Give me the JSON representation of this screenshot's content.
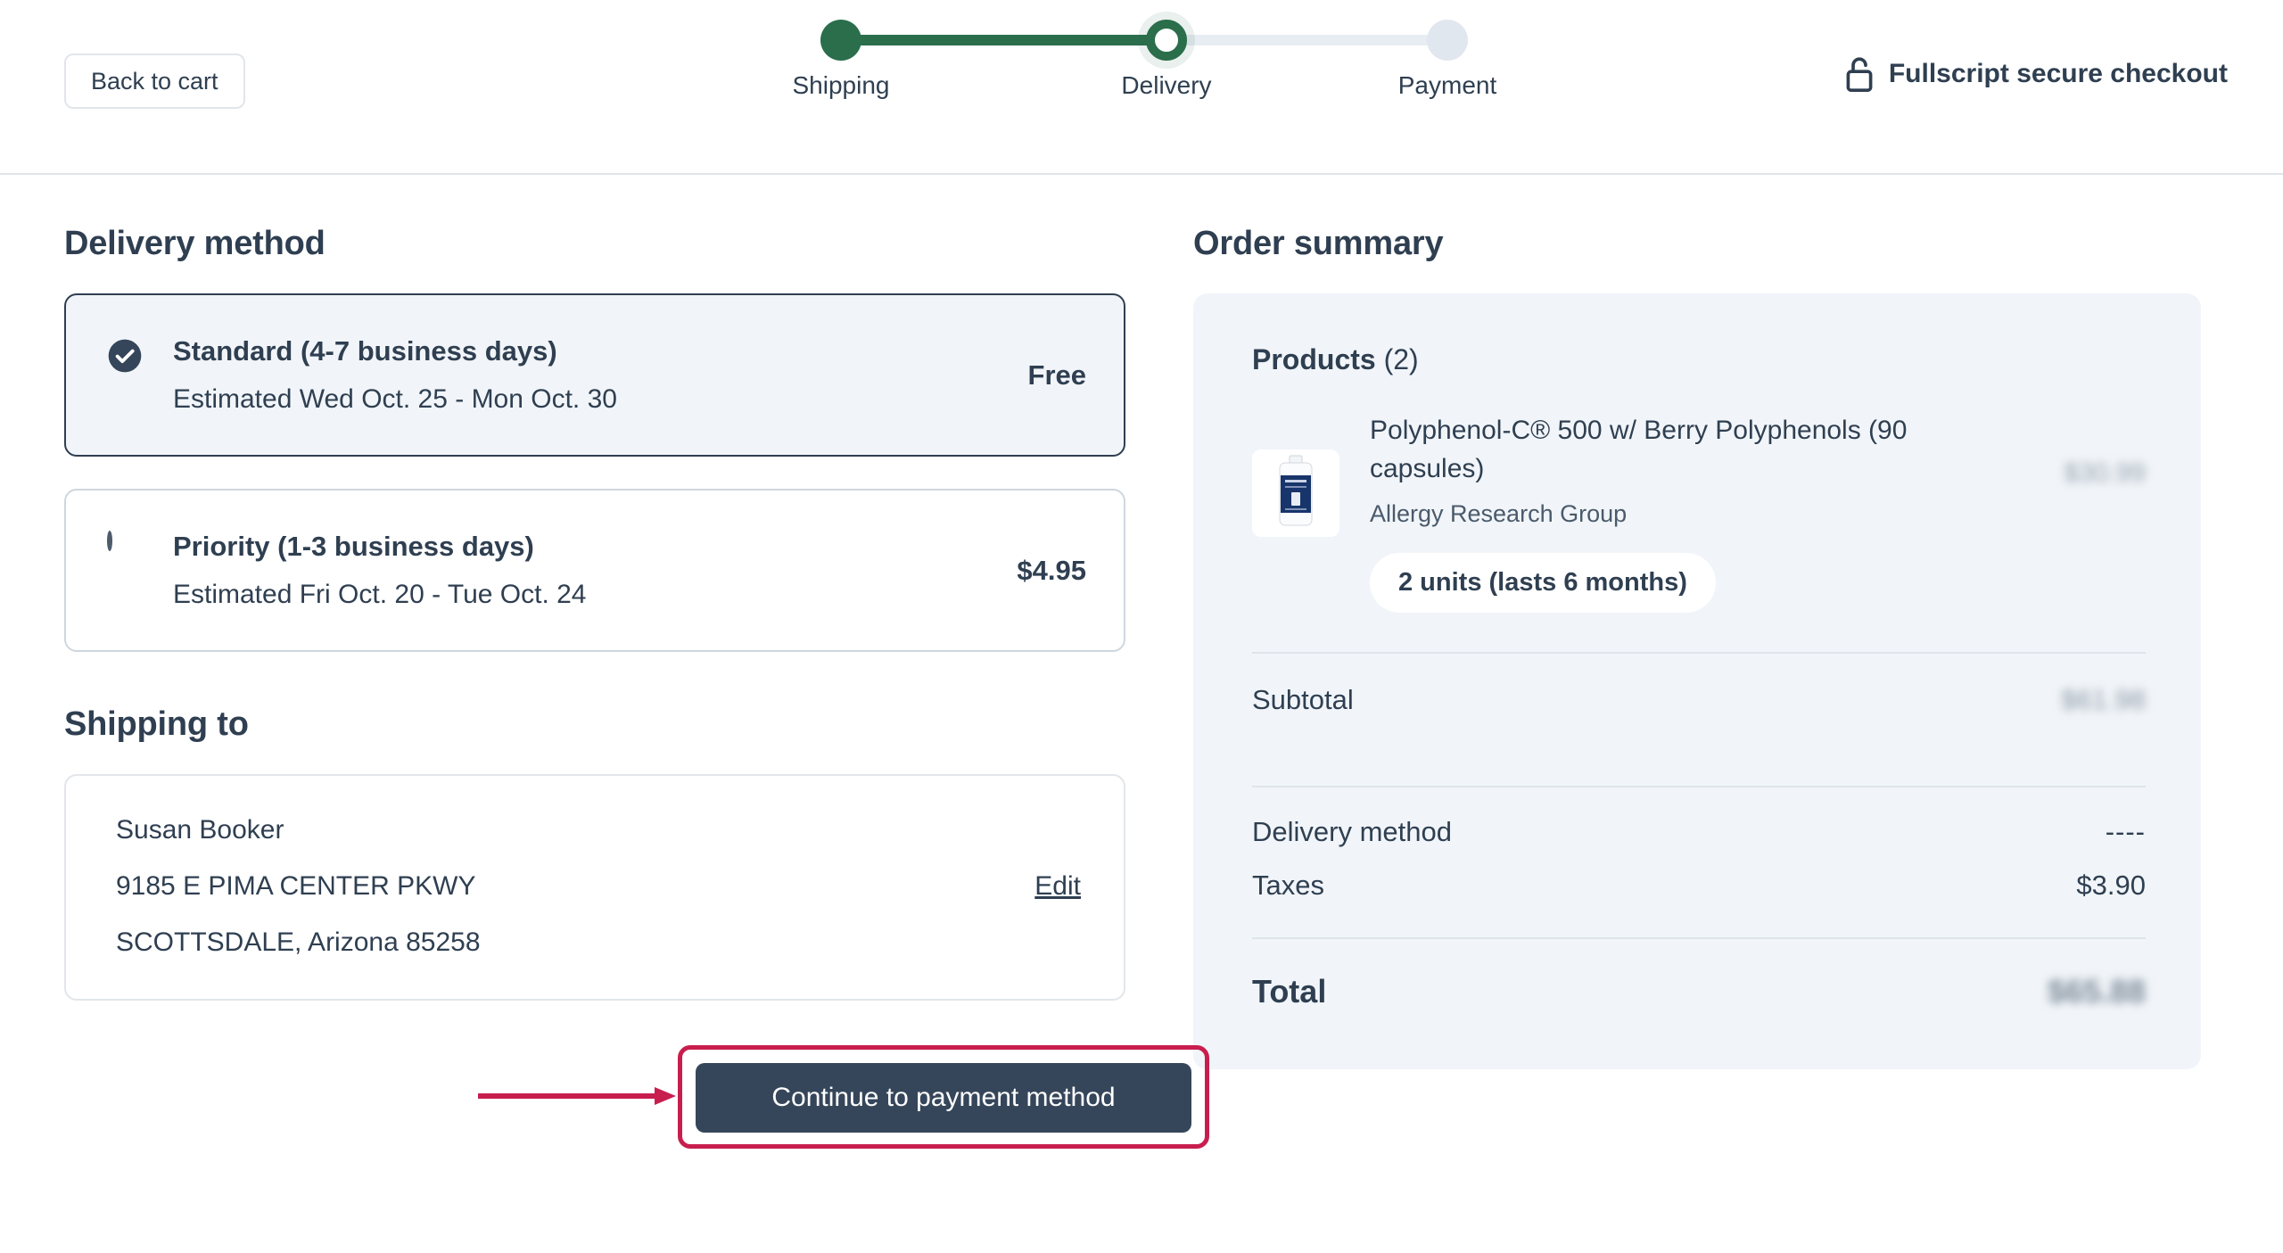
{
  "header": {
    "back_button": "Back to cart",
    "secure_text": "Fullscript secure checkout",
    "lock_icon": "open-padlock-icon",
    "steps": [
      {
        "label": "Shipping",
        "state": "completed"
      },
      {
        "label": "Delivery",
        "state": "current"
      },
      {
        "label": "Payment",
        "state": "upcoming"
      }
    ]
  },
  "colors": {
    "brand_green": "#2a6e4b",
    "track_inactive": "#e8edf3",
    "text_dark": "#2f3f51",
    "cta_bg": "#36465a",
    "panel_bg": "#f1f5f9",
    "annotation_red": "#c81e4e"
  },
  "delivery": {
    "title": "Delivery method",
    "options": [
      {
        "id": "standard",
        "title": "Standard (4-7 business days)",
        "estimate": "Estimated Wed Oct. 25 - Mon Oct. 30",
        "price": "Free",
        "selected": true
      },
      {
        "id": "priority",
        "title": "Priority (1-3 business days)",
        "estimate": "Estimated Fri Oct. 20 - Tue Oct. 24",
        "price": "$4.95",
        "selected": false
      }
    ]
  },
  "shipping": {
    "title": "Shipping to",
    "name": "Susan Booker",
    "street": "9185 E PIMA CENTER PKWY",
    "city_state_zip": "SCOTTSDALE, Arizona 85258",
    "edit_label": "Edit"
  },
  "cta": {
    "label": "Continue to payment method",
    "annotated": true
  },
  "summary": {
    "title": "Order summary",
    "products_label": "Products",
    "products_count": "(2)",
    "items": [
      {
        "name": "Polyphenol-C® 500 w/ Berry Polyphenols (90 capsules)",
        "brand": "Allergy Research Group",
        "units_badge": "2 units (lasts 6 months)",
        "price": "$30.99",
        "price_blurred": true,
        "thumbnail": "supplement-bottle-icon"
      }
    ],
    "rows": [
      {
        "label": "Subtotal",
        "value": "$61.98",
        "blurred": true,
        "style": "normal"
      },
      {
        "label": "Delivery method",
        "value": "----",
        "blurred": false,
        "style": "dashes"
      },
      {
        "label": "Taxes",
        "value": "$3.90",
        "blurred": false,
        "style": "normal"
      }
    ],
    "total": {
      "label": "Total",
      "value": "$65.88",
      "blurred": true
    }
  }
}
